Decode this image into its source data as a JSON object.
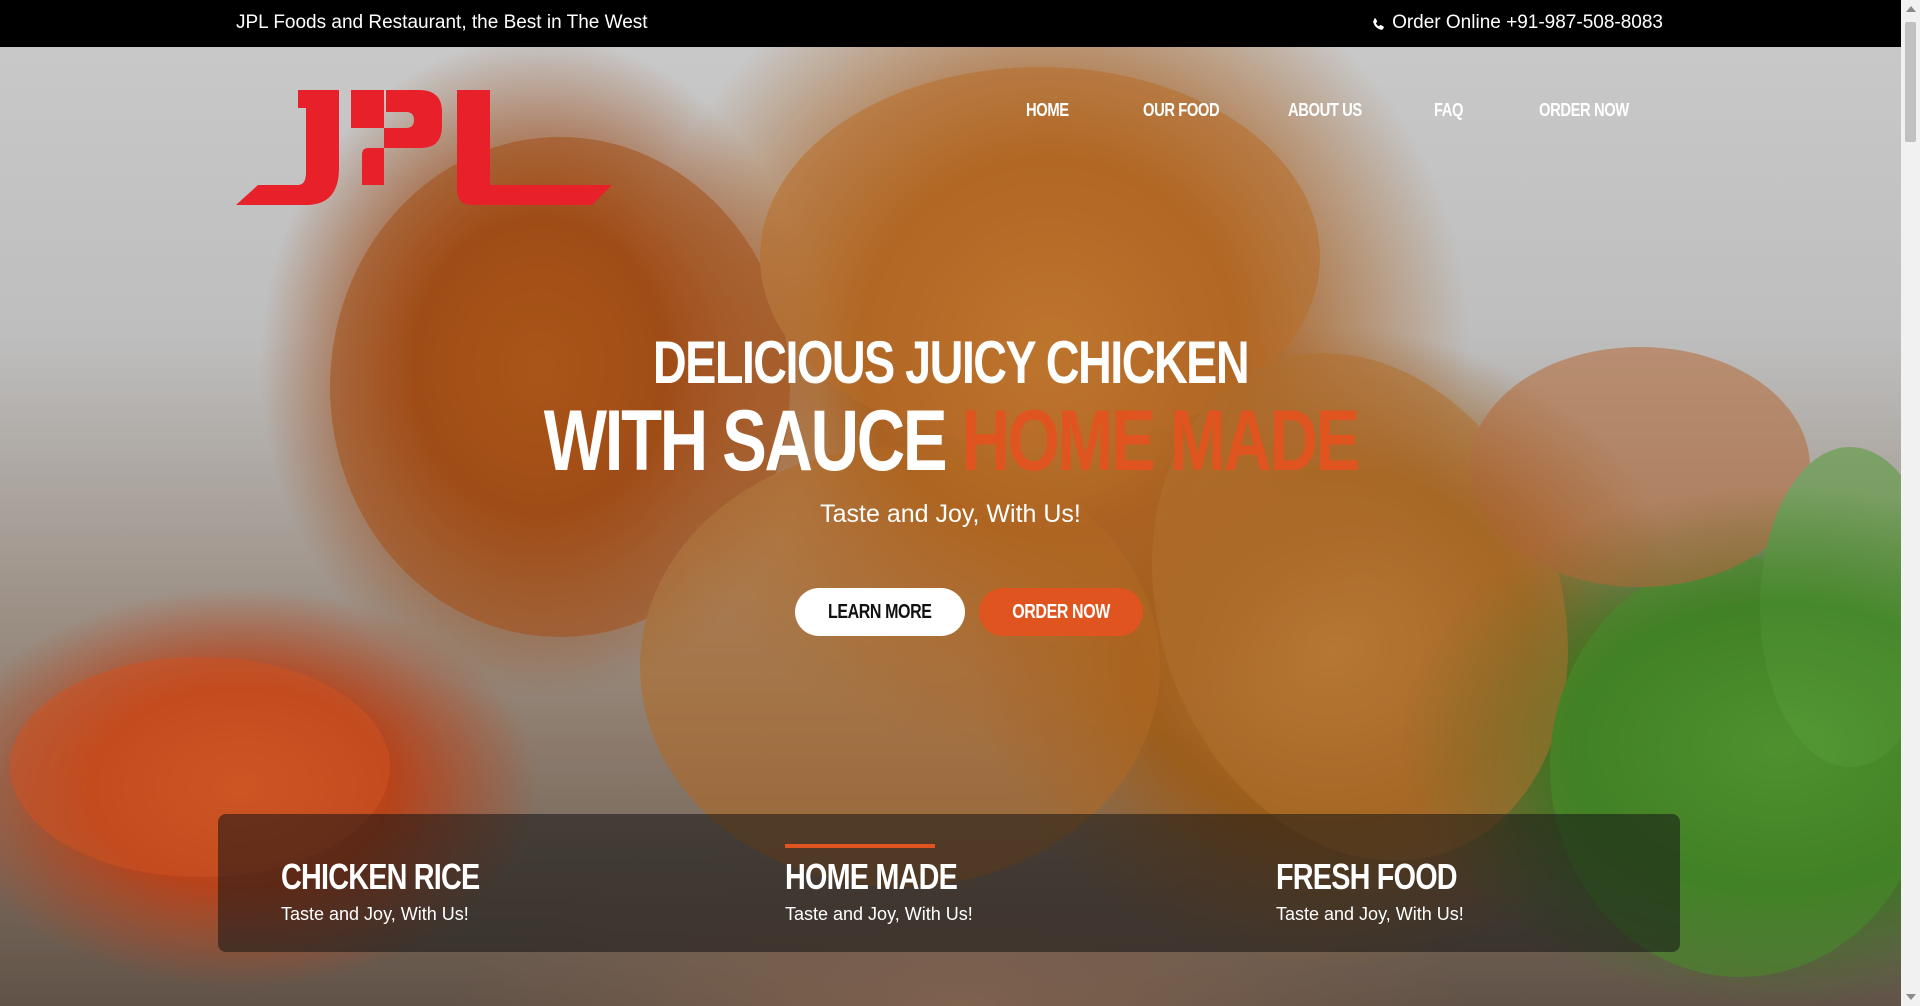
{
  "topbar": {
    "tagline": "JPL Foods and Restaurant, the Best in The West",
    "order_online": "Order Online +91-987-508-8083",
    "phone_icon": "phone-icon"
  },
  "logo": {
    "text": "JPL",
    "color": "#e8202a"
  },
  "nav": {
    "items": [
      {
        "label": "HOME"
      },
      {
        "label": "OUR FOOD"
      },
      {
        "label": "ABOUT US"
      },
      {
        "label": "FAQ"
      },
      {
        "label": "ORDER NOW"
      }
    ]
  },
  "hero": {
    "headline_1": "DELICIOUS JUICY CHICKEN",
    "headline_2_white": "WITH SAUCE",
    "headline_2_accent": "HOME MADE",
    "subtitle": "Taste and Joy, With Us!",
    "learn_more": "LEARN MORE",
    "order_now": "ORDER NOW"
  },
  "features": [
    {
      "title": "CHICKEN RICE",
      "desc": "Taste and Joy, With Us!"
    },
    {
      "title": "HOME MADE",
      "desc": "Taste and Joy, With Us!"
    },
    {
      "title": "FRESH FOOD",
      "desc": "Taste and Joy, With Us!"
    }
  ],
  "colors": {
    "accent": "#e0541f",
    "logo_red": "#e8202a",
    "topbar_bg": "#000000"
  }
}
